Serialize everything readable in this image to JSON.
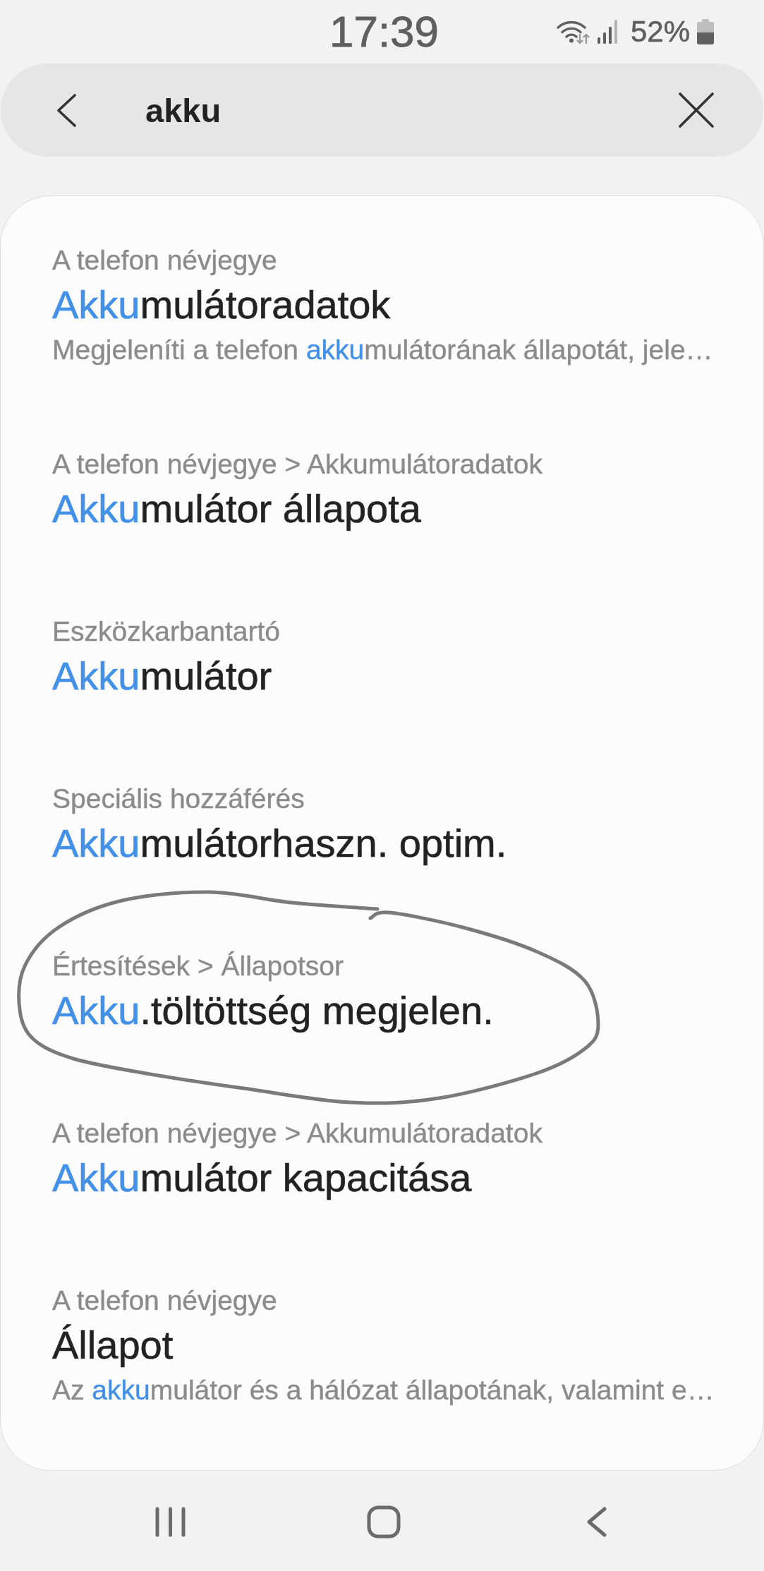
{
  "status_bar": {
    "time": "17:39",
    "battery": "52%"
  },
  "search": {
    "value": "akku"
  },
  "results": [
    {
      "path": "A telefon névjegye",
      "title": [
        {
          "text": "Akku",
          "highlight": true
        },
        {
          "text": "mulátoradatok",
          "highlight": false
        }
      ],
      "description": [
        {
          "text": "Megjeleníti a telefon ",
          "highlight": false
        },
        {
          "text": "akku",
          "highlight": true
        },
        {
          "text": "mulátorának állapotát, jele…",
          "highlight": false
        }
      ],
      "circled": false
    },
    {
      "path": "A telefon névjegye > Akkumulátoradatok",
      "title": [
        {
          "text": "Akku",
          "highlight": true
        },
        {
          "text": "mulátor állapota",
          "highlight": false
        }
      ],
      "circled": false
    },
    {
      "path": "Eszközkarbantartó",
      "title": [
        {
          "text": "Akku",
          "highlight": true
        },
        {
          "text": "mulátor",
          "highlight": false
        }
      ],
      "circled": false
    },
    {
      "path": "Speciális hozzáférés",
      "title": [
        {
          "text": "Akku",
          "highlight": true
        },
        {
          "text": "mulátorhaszn. optim.",
          "highlight": false
        }
      ],
      "circled": false
    },
    {
      "path": "Értesítések > Állapotsor",
      "title": [
        {
          "text": "Akku",
          "highlight": true
        },
        {
          "text": ".töltöttség megjelen.",
          "highlight": false
        }
      ],
      "circled": true
    },
    {
      "path": "A telefon névjegye > Akkumulátoradatok",
      "title": [
        {
          "text": "Akku",
          "highlight": true
        },
        {
          "text": "mulátor kapacitása",
          "highlight": false
        }
      ],
      "circled": false
    },
    {
      "path": "A telefon névjegye",
      "title": [
        {
          "text": "Állapot",
          "highlight": false
        }
      ],
      "description": [
        {
          "text": "Az ",
          "highlight": false
        },
        {
          "text": "akku",
          "highlight": true
        },
        {
          "text": "mulátor és a hálózat állapotának, valamint e…",
          "highlight": false
        }
      ],
      "circled": false
    }
  ]
}
